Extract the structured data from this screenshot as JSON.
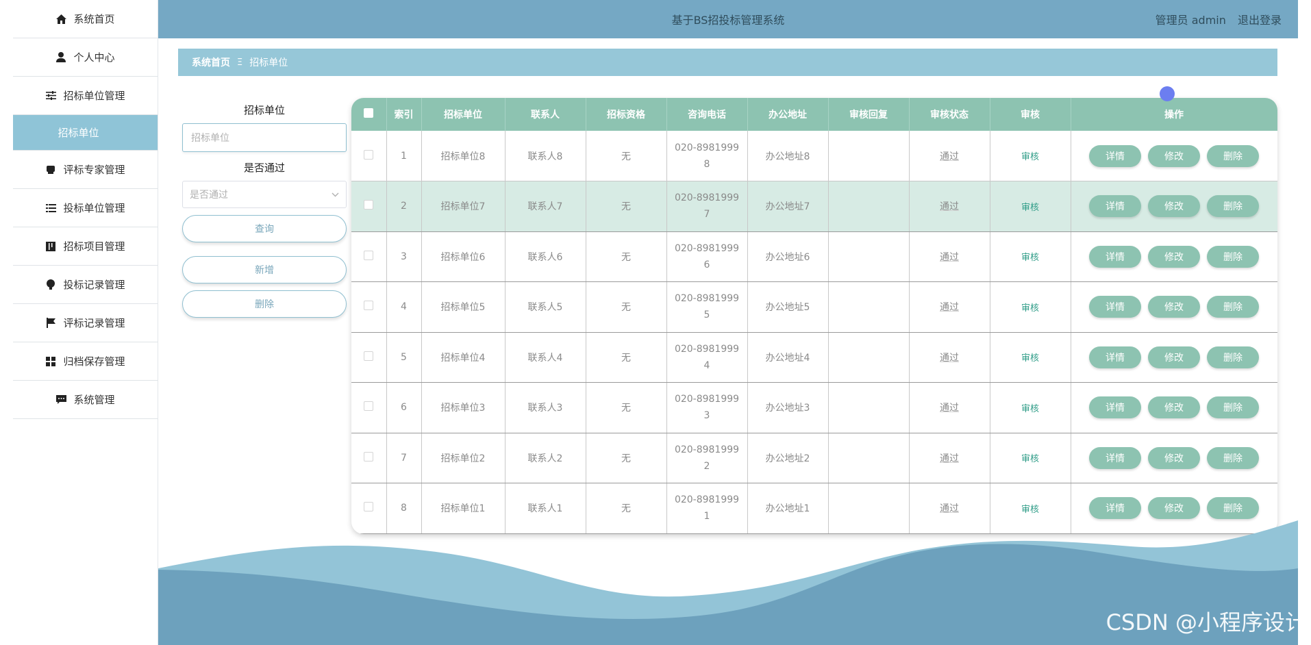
{
  "app": {
    "title": "基于BS招投标管理系统"
  },
  "header": {
    "user_label": "管理员 admin",
    "logout_label": "退出登录"
  },
  "sidebar": {
    "items": [
      {
        "label": "系统首页",
        "icon": "home-icon"
      },
      {
        "label": "个人中心",
        "icon": "user-icon"
      },
      {
        "label": "招标单位管理",
        "icon": "sliders-icon"
      },
      {
        "label": "招标单位",
        "icon": ""
      },
      {
        "label": "评标专家管理",
        "icon": "expert-icon"
      },
      {
        "label": "投标单位管理",
        "icon": "list-icon"
      },
      {
        "label": "招标项目管理",
        "icon": "book-icon"
      },
      {
        "label": "投标记录管理",
        "icon": "bulb-icon"
      },
      {
        "label": "评标记录管理",
        "icon": "flag-icon"
      },
      {
        "label": "归档保存管理",
        "icon": "grid-icon"
      },
      {
        "label": "系统管理",
        "icon": "chat-icon"
      }
    ]
  },
  "breadcrumb": {
    "home": "系统首页",
    "separator": "Ξ",
    "current": "招标单位"
  },
  "search": {
    "unit_label": "招标单位",
    "unit_placeholder": "招标单位",
    "pass_label": "是否通过",
    "pass_placeholder": "是否通过",
    "query_label": "查询",
    "add_label": "新增",
    "delete_label": "删除"
  },
  "table": {
    "columns": [
      "索引",
      "招标单位",
      "联系人",
      "招标资格",
      "咨询电话",
      "办公地址",
      "审核回复",
      "审核状态",
      "审核",
      "操作"
    ],
    "rows": [
      {
        "index": "1",
        "unit": "招标单位8",
        "contact": "联系人8",
        "qual": "无",
        "phone_a": "020-8981999",
        "phone_b": "8",
        "addr": "办公地址8",
        "reply": "",
        "status": "通过",
        "audit": "审核"
      },
      {
        "index": "2",
        "unit": "招标单位7",
        "contact": "联系人7",
        "qual": "无",
        "phone_a": "020-8981999",
        "phone_b": "7",
        "addr": "办公地址7",
        "reply": "",
        "status": "通过",
        "audit": "审核"
      },
      {
        "index": "3",
        "unit": "招标单位6",
        "contact": "联系人6",
        "qual": "无",
        "phone_a": "020-8981999",
        "phone_b": "6",
        "addr": "办公地址6",
        "reply": "",
        "status": "通过",
        "audit": "审核"
      },
      {
        "index": "4",
        "unit": "招标单位5",
        "contact": "联系人5",
        "qual": "无",
        "phone_a": "020-8981999",
        "phone_b": "5",
        "addr": "办公地址5",
        "reply": "",
        "status": "通过",
        "audit": "审核"
      },
      {
        "index": "5",
        "unit": "招标单位4",
        "contact": "联系人4",
        "qual": "无",
        "phone_a": "020-8981999",
        "phone_b": "4",
        "addr": "办公地址4",
        "reply": "",
        "status": "通过",
        "audit": "审核"
      },
      {
        "index": "6",
        "unit": "招标单位3",
        "contact": "联系人3",
        "qual": "无",
        "phone_a": "020-8981999",
        "phone_b": "3",
        "addr": "办公地址3",
        "reply": "",
        "status": "通过",
        "audit": "审核"
      },
      {
        "index": "7",
        "unit": "招标单位2",
        "contact": "联系人2",
        "qual": "无",
        "phone_a": "020-8981999",
        "phone_b": "2",
        "addr": "办公地址2",
        "reply": "",
        "status": "通过",
        "audit": "审核"
      },
      {
        "index": "8",
        "unit": "招标单位1",
        "contact": "联系人1",
        "qual": "无",
        "phone_a": "020-8981999",
        "phone_b": "1",
        "addr": "办公地址1",
        "reply": "",
        "status": "通过",
        "audit": "审核"
      }
    ],
    "actions": {
      "detail": "详情",
      "edit": "修改",
      "delete": "删除"
    }
  },
  "watermark": "CSDN @小程序设计",
  "colors": {
    "header": "#75a8c4",
    "accent": "#8dc3b1",
    "active_nav": "#8fc4d7",
    "breadcrumb": "#96c7d8"
  }
}
